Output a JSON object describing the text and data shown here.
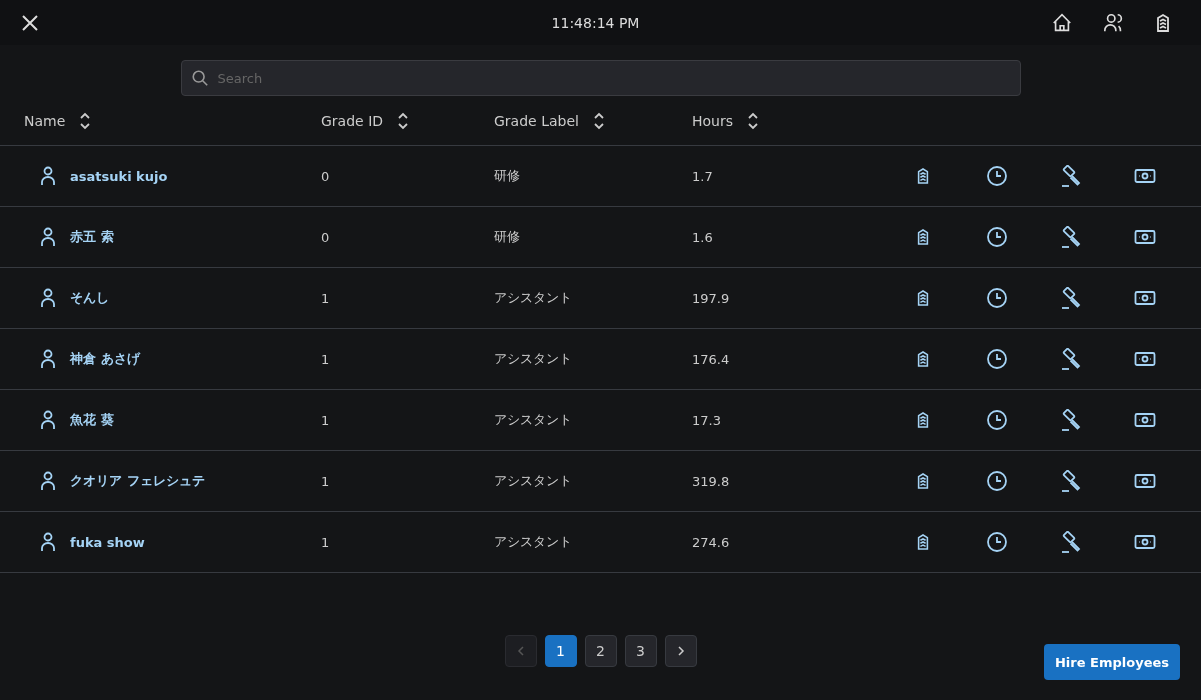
{
  "header": {
    "time": "11:48:14 PM"
  },
  "search": {
    "placeholder": "Search"
  },
  "table": {
    "columns": [
      {
        "label": "Name"
      },
      {
        "label": "Grade ID"
      },
      {
        "label": "Grade Label"
      },
      {
        "label": "Hours"
      }
    ],
    "rows": [
      {
        "name": "asatsuki kujo",
        "grade_id": "0",
        "grade_label": "研修",
        "hours": "1.7"
      },
      {
        "name": "赤五 索",
        "grade_id": "0",
        "grade_label": "研修",
        "hours": "1.6"
      },
      {
        "name": "そんし",
        "grade_id": "1",
        "grade_label": "アシスタント",
        "hours": "197.9"
      },
      {
        "name": "神倉 あさげ",
        "grade_id": "1",
        "grade_label": "アシスタント",
        "hours": "176.4"
      },
      {
        "name": "魚花 葵",
        "grade_id": "1",
        "grade_label": "アシスタント",
        "hours": "17.3"
      },
      {
        "name": "クオリア フェレシュテ",
        "grade_id": "1",
        "grade_label": "アシスタント",
        "hours": "319.8"
      },
      {
        "name": "fuka show",
        "grade_id": "1",
        "grade_label": "アシスタント",
        "hours": "274.6"
      }
    ]
  },
  "pagination": {
    "prev_disabled": true,
    "pages": [
      {
        "label": "1",
        "selected": true
      },
      {
        "label": "2",
        "selected": false
      },
      {
        "label": "3",
        "selected": false
      }
    ]
  },
  "hire_button": "Hire Employees"
}
